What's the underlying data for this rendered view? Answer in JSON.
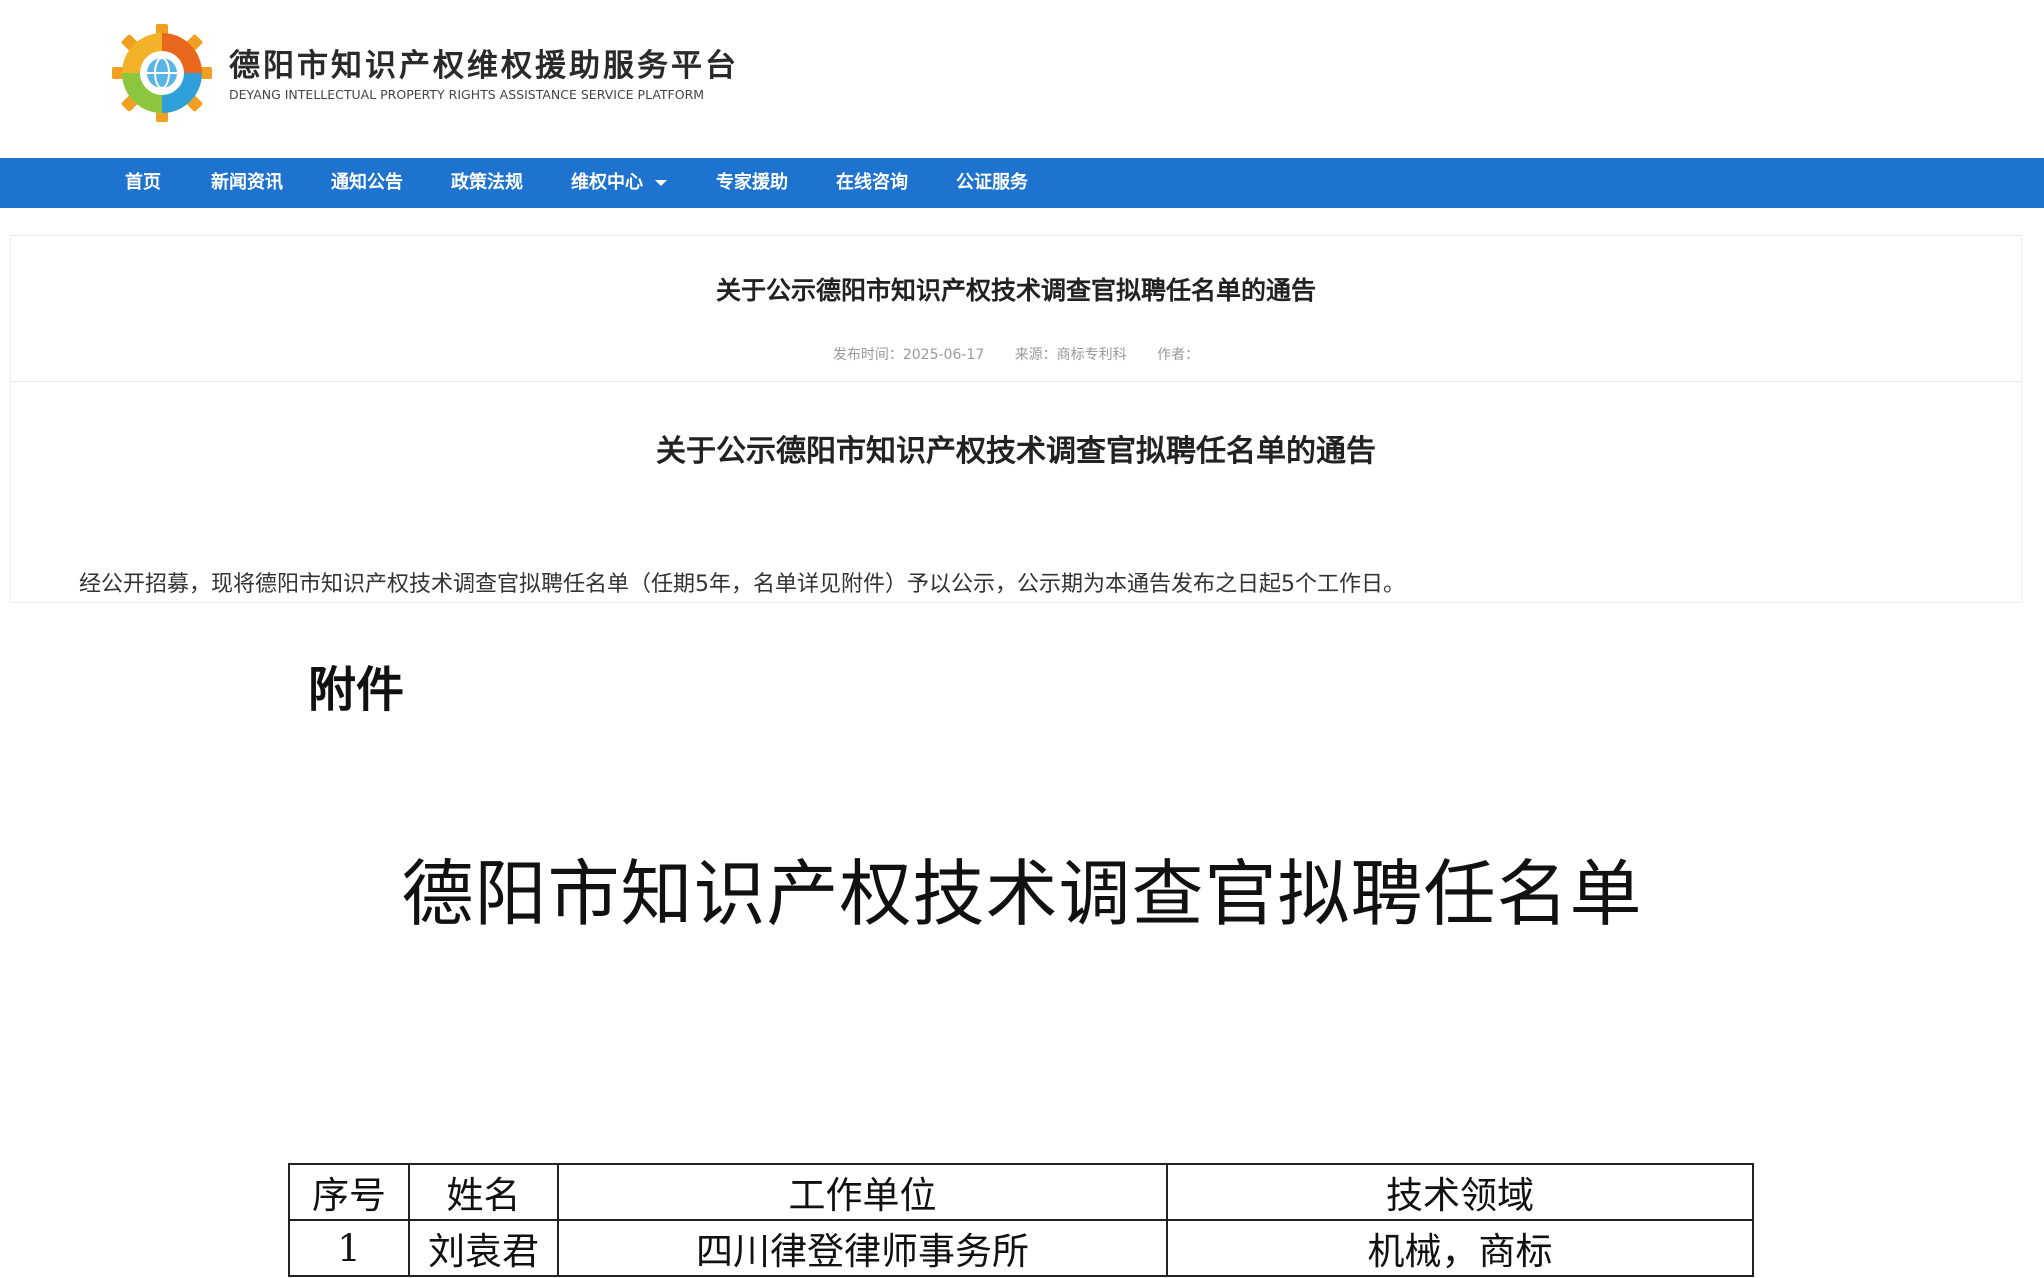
{
  "site": {
    "name_cn": "德阳市知识产权维权援助服务平台",
    "name_en": "DEYANG INTELLECTUAL PROPERTY RIGHTS ASSISTANCE SERVICE PLATFORM",
    "logo_icon": "gear-globe-logo-icon"
  },
  "nav": {
    "items": [
      "首页",
      "新闻资讯",
      "通知公告",
      "政策法规",
      "维权中心",
      "专家援助",
      "在线咨询",
      "公证服务"
    ],
    "accent_color": "#1e73cf"
  },
  "article": {
    "title": "关于公示德阳市知识产权技术调查官拟聘任名单的通告",
    "meta": {
      "publish": "发布时间：2025-06-17",
      "source": "来源：商标专利科",
      "author": "作者："
    },
    "doc_title": "关于公示德阳市知识产权技术调查官拟聘任名单的通告",
    "body": "经公开招募，现将德阳市知识产权技术调查官拟聘任名单（任期5年，名单详见附件）予以公示，公示期为本通告发布之日起5个工作日。"
  },
  "attachment": {
    "label": "附件",
    "title": "德阳市知识产权技术调查官拟聘任名单",
    "table": {
      "headers": [
        "序号",
        "姓名",
        "工作单位",
        "技术领域"
      ],
      "rows": [
        [
          "1",
          "刘袁君",
          "四川律登律师事务所",
          "机械，商标"
        ]
      ]
    }
  }
}
